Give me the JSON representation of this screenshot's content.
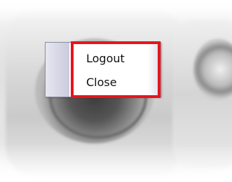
{
  "context_menu": {
    "items": [
      {
        "label": "Logout"
      },
      {
        "label": "Close"
      }
    ]
  },
  "annotation": {
    "highlight_color": "#e8141b"
  },
  "colors": {
    "menu_gutter": "#c9cbdd",
    "menu_border": "#8f8f9f"
  }
}
